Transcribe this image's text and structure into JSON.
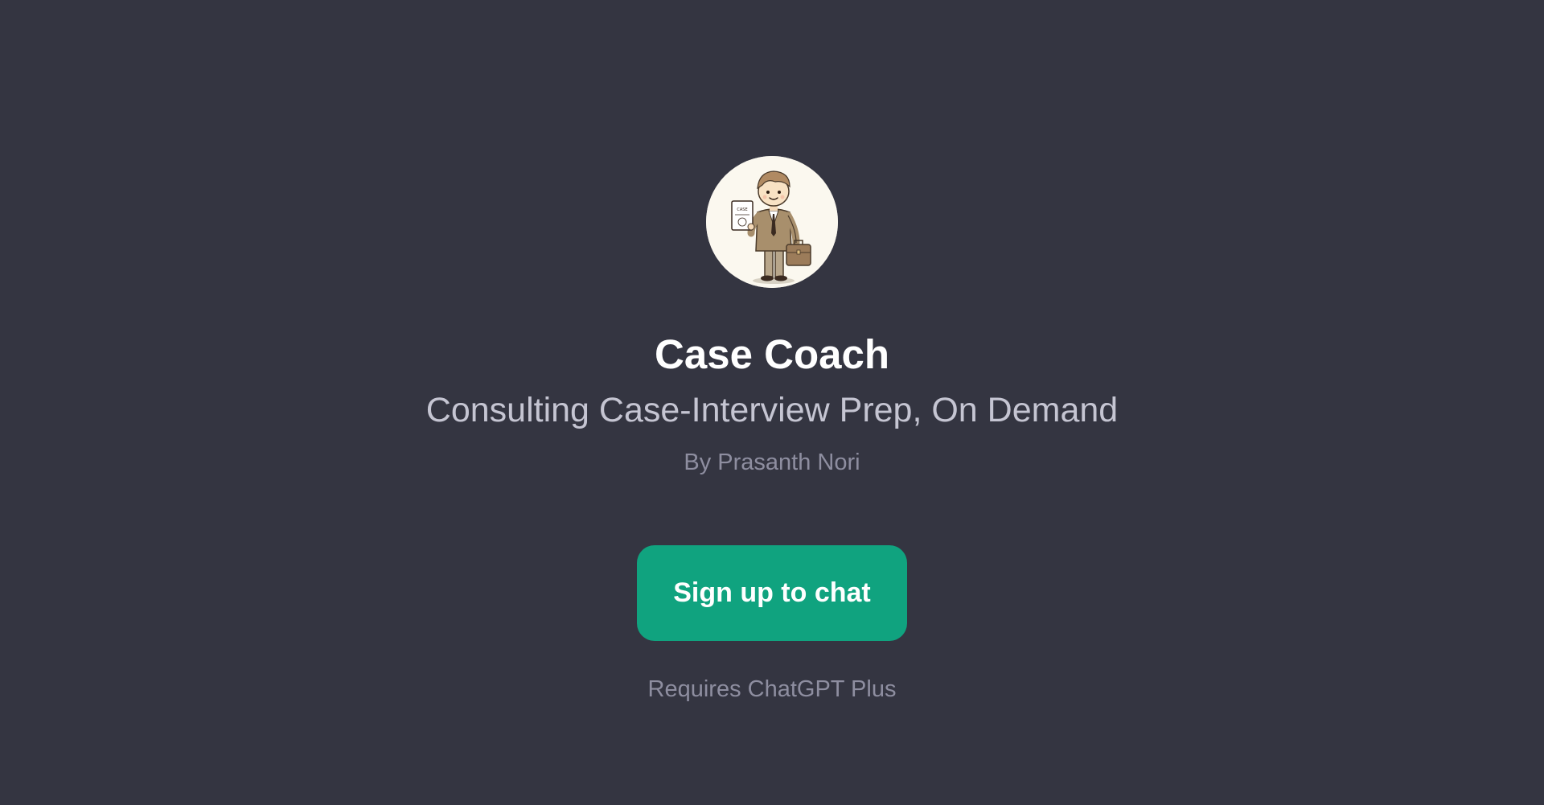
{
  "gpt": {
    "title": "Case Coach",
    "description": "Consulting Case-Interview Prep, On Demand",
    "author": "By Prasanth Nori",
    "avatar_icon": "consultant-cartoon-icon",
    "avatar_book_text": "CASE"
  },
  "actions": {
    "signup_label": "Sign up to chat"
  },
  "footer": {
    "requirement": "Requires ChatGPT Plus"
  },
  "colors": {
    "background": "#343541",
    "accent": "#10a37f",
    "title": "#ffffff",
    "subtitle": "#c5c5d2",
    "muted": "#8e8ea0"
  }
}
